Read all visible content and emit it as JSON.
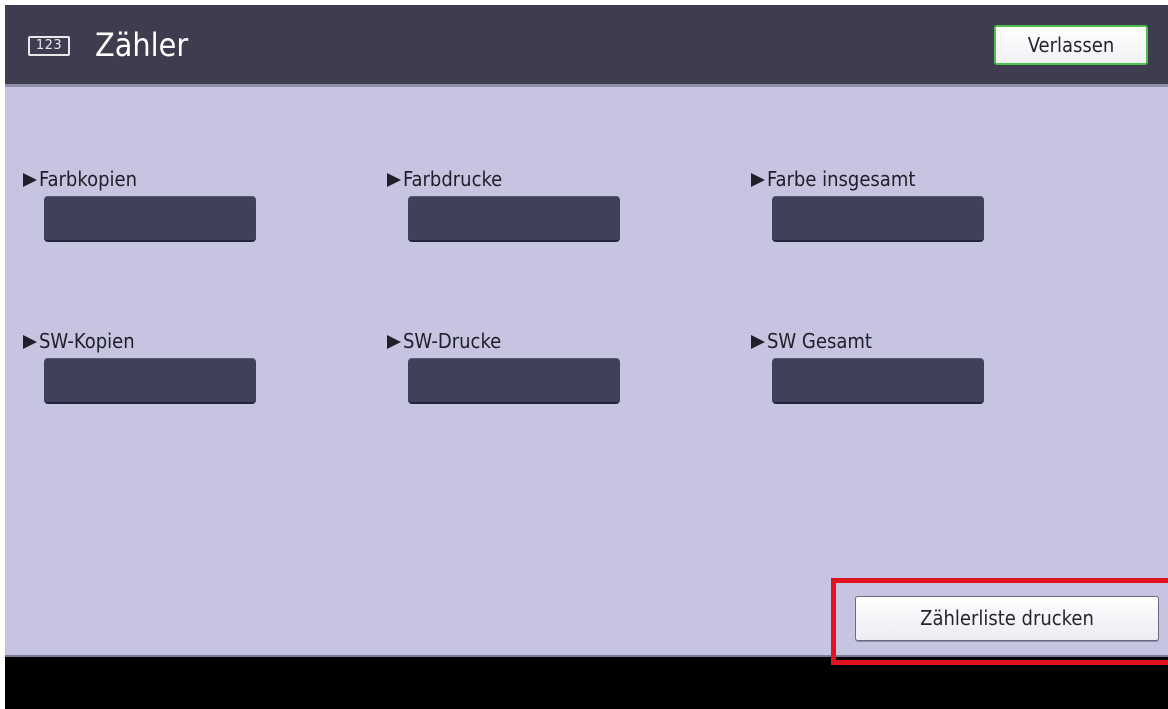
{
  "header": {
    "icon_text": "123",
    "title": "Zähler",
    "exit_label": "Verlassen"
  },
  "counters": [
    {
      "label": "Farbkopien",
      "value": ""
    },
    {
      "label": "Farbdrucke",
      "value": ""
    },
    {
      "label": "Farbe insgesamt",
      "value": ""
    },
    {
      "label": "SW-Kopien",
      "value": ""
    },
    {
      "label": "SW-Drucke",
      "value": ""
    },
    {
      "label": "SW Gesamt",
      "value": ""
    }
  ],
  "actions": {
    "print_list_label": "Zählerliste drucken"
  },
  "colors": {
    "header": "#3d3d4f",
    "content": "#c6c4e0",
    "value_field": "#40405a",
    "exit_border": "#4fbf4f",
    "highlight": "#e0141e"
  }
}
